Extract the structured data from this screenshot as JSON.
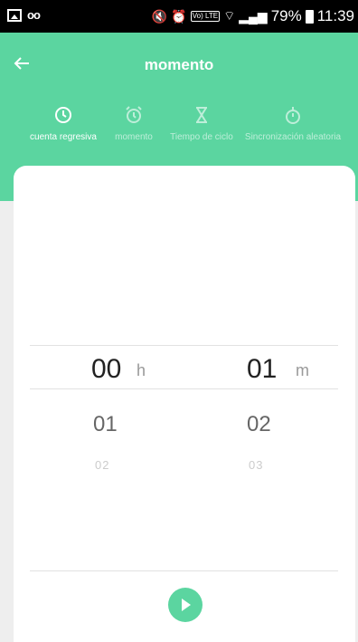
{
  "status_bar": {
    "voicemail": "oo",
    "lte": "Vo) LTE",
    "battery": "79%",
    "time": "11:39"
  },
  "header": {
    "title": "momento"
  },
  "tabs": [
    {
      "label": "cuenta regresiva",
      "icon": "clock-icon"
    },
    {
      "label": "momento",
      "icon": "alarm-clock-icon"
    },
    {
      "label": "Tiempo de ciclo",
      "icon": "hourglass-icon"
    },
    {
      "label": "Sincronización aleatoria",
      "icon": "stopwatch-icon"
    }
  ],
  "picker": {
    "hours": {
      "selected": "00",
      "unit": "h",
      "next": "01",
      "next2": "02"
    },
    "minutes": {
      "selected": "01",
      "unit": "m",
      "next": "02",
      "next2": "03"
    }
  },
  "colors": {
    "accent": "#5bd5a0"
  }
}
